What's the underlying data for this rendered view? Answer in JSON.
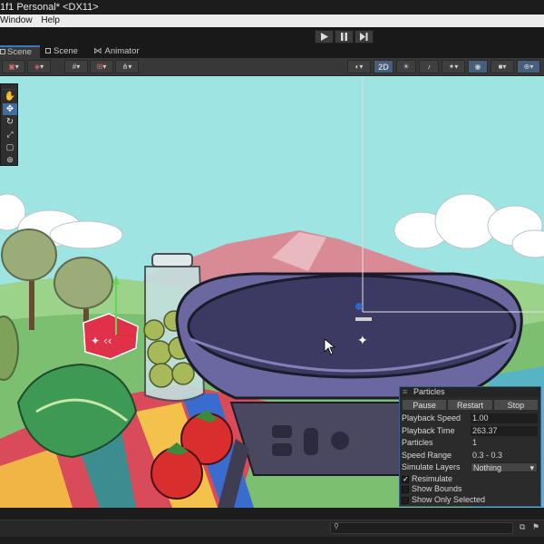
{
  "window": {
    "title": "1f1 Personal* <DX11>"
  },
  "menu": {
    "items": [
      "Window",
      "Help"
    ]
  },
  "play": {
    "play_icon": "play-icon",
    "pause_icon": "pause-icon",
    "step_icon": "step-icon"
  },
  "tabs": [
    {
      "label": "Scene",
      "icon": "grid-icon"
    },
    {
      "label": "Scene",
      "icon": "grid-icon"
    },
    {
      "label": "Animator",
      "icon": "animator-icon"
    }
  ],
  "scene_toolbar": {
    "mode_2d": "2D"
  },
  "tools": [
    "hand-tool-icon",
    "move-tool-icon",
    "rotate-tool-icon",
    "scale-tool-icon",
    "rect-tool-icon",
    "transform-tool-icon"
  ],
  "particles": {
    "title": "Particles",
    "buttons": [
      "Pause",
      "Restart",
      "Stop"
    ],
    "fields": [
      {
        "label": "Playback Speed",
        "value": "1.00"
      },
      {
        "label": "Playback Time",
        "value": "263.37"
      },
      {
        "label": "Particles",
        "value": "1"
      },
      {
        "label": "Speed Range",
        "value": "0.3 - 0.3"
      }
    ],
    "simulate_layers": {
      "label": "Simulate Layers",
      "value": "Nothing"
    },
    "checks": [
      {
        "label": "Resimulate",
        "checked": true
      },
      {
        "label": "Show Bounds",
        "checked": false
      },
      {
        "label": "Show Only Selected",
        "checked": false
      }
    ]
  },
  "colors": {
    "accent": "#3a79bb",
    "sky": "#9ee4e2",
    "panel": "#383838",
    "pot": "#5e5a8c"
  }
}
